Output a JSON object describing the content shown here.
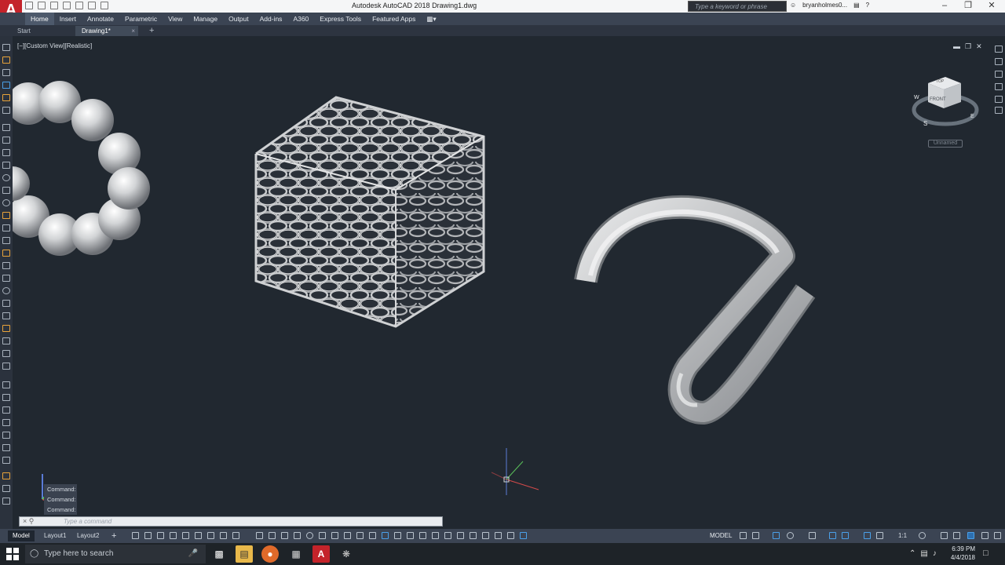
{
  "title_bar": {
    "app_logo": "A",
    "title": "Autodesk AutoCAD 2018    Drawing1.dwg",
    "search_placeholder": "Type a keyword or phrase",
    "user": "bryanholmes0..."
  },
  "ribbon": {
    "tabs": [
      {
        "label": "Home",
        "active": true
      },
      {
        "label": "Insert"
      },
      {
        "label": "Annotate"
      },
      {
        "label": "Parametric"
      },
      {
        "label": "View"
      },
      {
        "label": "Manage"
      },
      {
        "label": "Output"
      },
      {
        "label": "Add-ins"
      },
      {
        "label": "A360"
      },
      {
        "label": "Express Tools"
      },
      {
        "label": "Featured Apps"
      }
    ]
  },
  "file_tabs": {
    "start": "Start",
    "drawing": "Drawing1*"
  },
  "viewport": {
    "view_label": "[−][Custom View][Realistic]",
    "viewcube": {
      "top": "TOP",
      "front": "FRONT",
      "compass_w": "W",
      "compass_s": "S",
      "compass_e": "E",
      "wcs_label": "Unnamed"
    }
  },
  "command": {
    "history": [
      "Command:",
      "Command:",
      "Command:"
    ],
    "placeholder": "Type a command"
  },
  "layout_tabs": [
    "Model",
    "Layout1",
    "Layout2"
  ],
  "status": {
    "model": "MODEL",
    "scale": "1:1"
  },
  "taskbar": {
    "search_placeholder": "Type here to search",
    "time": "6:39 PM",
    "date": "4/4/2018"
  },
  "colors": {
    "accent": "#c4232a",
    "viewport_bg": "#212830",
    "ribbon": "#3b4453"
  }
}
